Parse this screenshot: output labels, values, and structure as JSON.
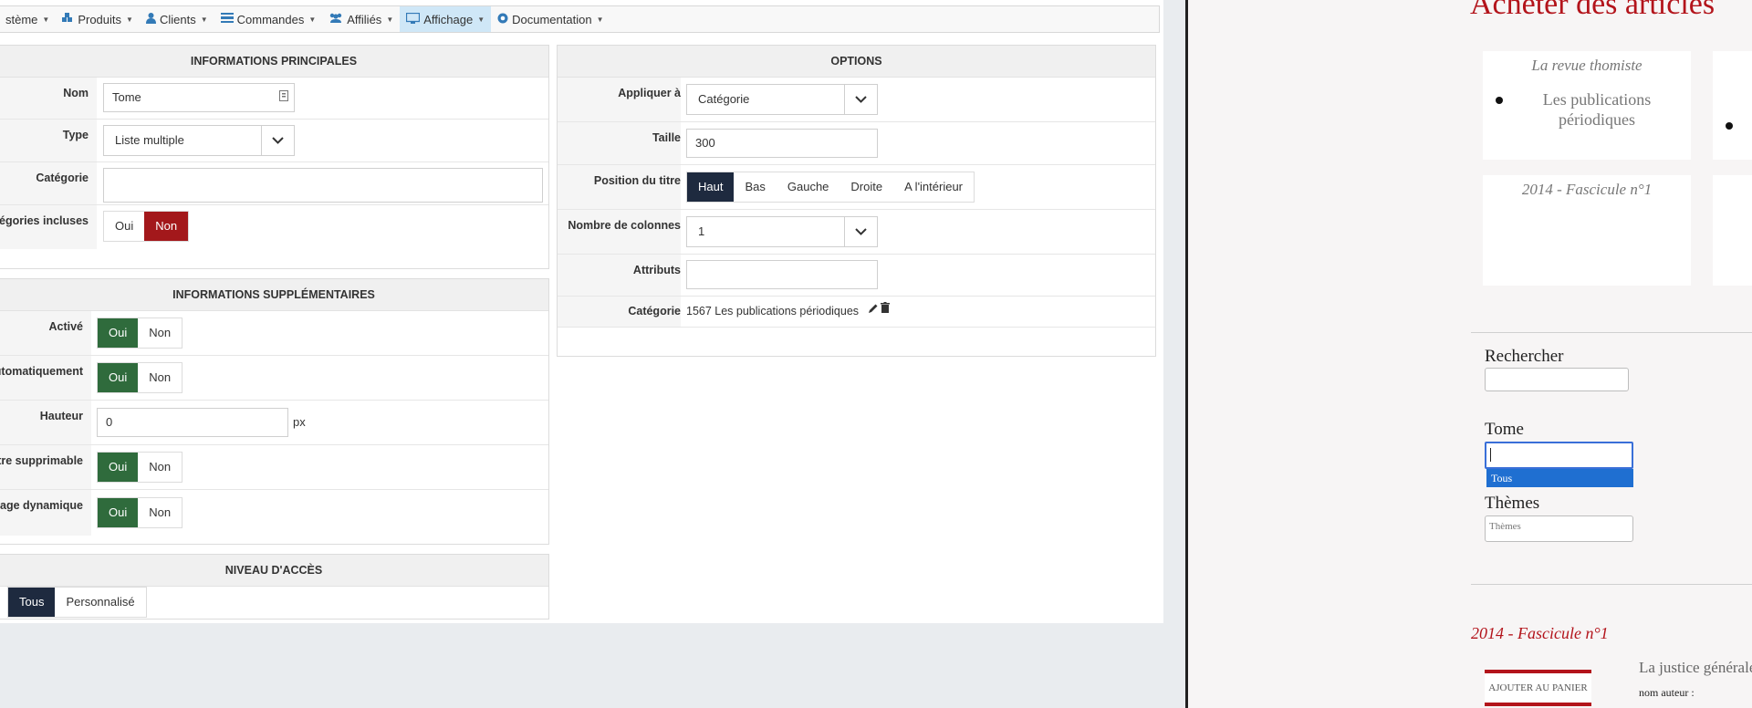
{
  "menu": [
    {
      "label": "stème",
      "icon": "",
      "active": false
    },
    {
      "label": "Produits",
      "icon": "cubes-icon",
      "active": false
    },
    {
      "label": "Clients",
      "icon": "user-icon",
      "active": false
    },
    {
      "label": "Commandes",
      "icon": "list-icon",
      "active": false
    },
    {
      "label": "Affiliés",
      "icon": "users-icon",
      "active": false
    },
    {
      "label": "Affichage",
      "icon": "monitor-icon",
      "active": true
    },
    {
      "label": "Documentation",
      "icon": "lifebuoy-icon",
      "active": false
    }
  ],
  "main_info": {
    "title": "INFORMATIONS PRINCIPALES",
    "nom_label": "Nom",
    "nom_value": "Tome",
    "type_label": "Type",
    "type_value": "Liste multiple",
    "categorie_label": "Catégorie",
    "categorie_value": "",
    "incluses_label": "tégories incluses",
    "oui": "Oui",
    "non": "Non"
  },
  "extra_info": {
    "title": "INFORMATIONS SUPPLÉMENTAIRES",
    "active_label": "Activé",
    "auto_label": "utomatiquement",
    "hauteur_label": "Hauteur",
    "hauteur_value": "0",
    "hauteur_unit": "px",
    "supprimable_label": "ltre supprimable",
    "dynamique_label": "hage dynamique",
    "oui": "Oui",
    "non": "Non"
  },
  "access": {
    "title": "NIVEAU D'ACCÈS",
    "tous": "Tous",
    "personnalise": "Personnalisé"
  },
  "options": {
    "title": "OPTIONS",
    "appliquer_label": "Appliquer à",
    "appliquer_value": "Catégorie",
    "taille_label": "Taille",
    "taille_value": "300",
    "position_label": "Position du titre",
    "positions": [
      "Haut",
      "Bas",
      "Gauche",
      "Droite",
      "A l'intérieur"
    ],
    "colonnes_label": "Nombre de colonnes",
    "colonnes_value": "1",
    "attributs_label": "Attributs",
    "attributs_value": "",
    "categorie_label": "Catégorie",
    "categorie_value": "1567 Les publications périodiques"
  },
  "preview": {
    "title": "Acheter des articles",
    "card1_title": "La revue thomiste",
    "card1_item": "Les publications périodiques",
    "card2_title": "2014 - Fascicule n°1",
    "search_label": "Rechercher",
    "tome_label": "Tome",
    "tome_option": "Tous",
    "themes_label": "Thèmes",
    "themes_placeholder": "Thèmes",
    "fascicule": "2014 - Fascicule n°1",
    "cart_button": "AJOUTER AU PANIER",
    "article_title": "La justice générale",
    "article_author": "nom auteur :"
  },
  "colors": {
    "green": "#2f6b3c",
    "red": "#a3181b",
    "navy": "#1e2a3f",
    "preview_red": "#b3141b",
    "dropdown_blue": "#1f6fd1"
  }
}
